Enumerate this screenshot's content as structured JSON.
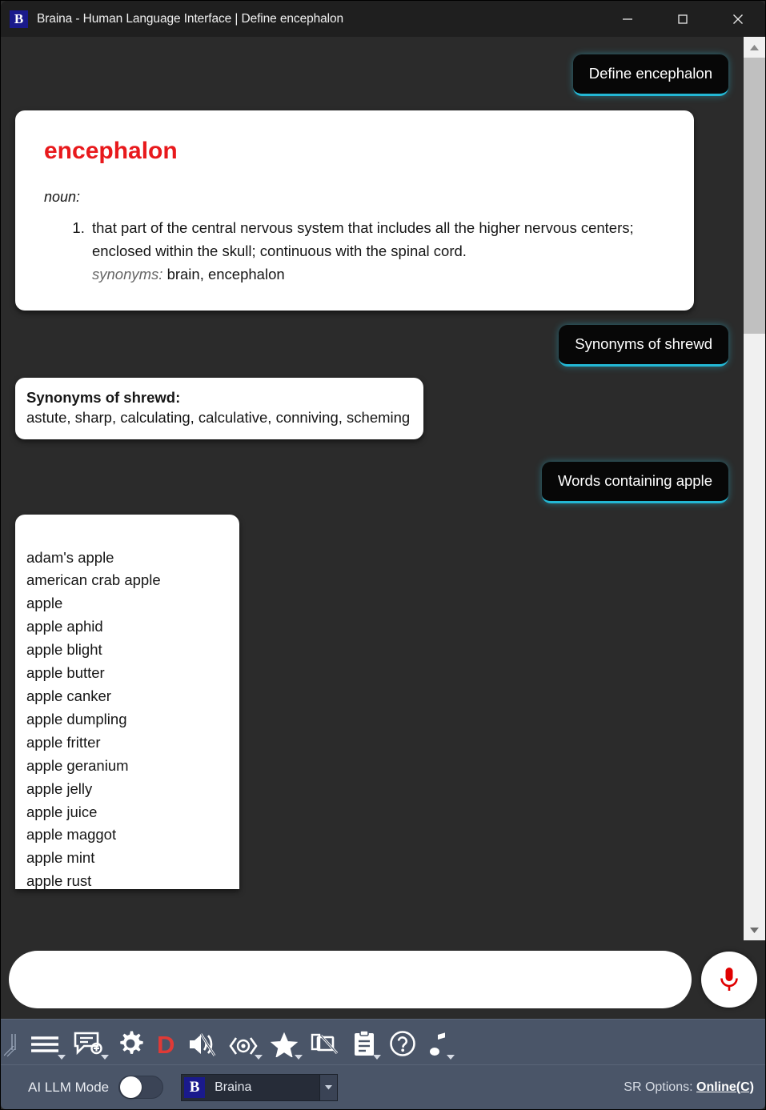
{
  "window": {
    "logo_letter": "B",
    "title": "Braina - Human Language Interface | Define encephalon",
    "controls": {
      "minimize": "minimize-button",
      "maximize": "maximize-button",
      "close": "close-button"
    }
  },
  "conversation": [
    {
      "role": "user",
      "text": "Define encephalon"
    },
    {
      "role": "assistant",
      "type": "definition",
      "headword": "encephalon",
      "part_of_speech": "noun:",
      "definitions": [
        "that part of the central nervous system that includes all the higher nervous centers; enclosed within the skull; continuous with the spinal cord."
      ],
      "synonyms_label": "synonyms:",
      "synonyms_value": "brain, encephalon"
    },
    {
      "role": "user",
      "text": "Synonyms of shrewd"
    },
    {
      "role": "assistant",
      "type": "synonyms",
      "title": "Synonyms of shrewd:",
      "body": "astute, sharp, calculating, calculative, conniving, scheming"
    },
    {
      "role": "user",
      "text": "Words containing apple"
    },
    {
      "role": "assistant",
      "type": "word-list",
      "items": [
        "adam's apple",
        "american crab apple",
        "apple",
        "apple aphid",
        "apple blight",
        "apple butter",
        "apple canker",
        "apple dumpling",
        "apple fritter",
        "apple geranium",
        "apple jelly",
        "apple juice",
        "apple maggot",
        "apple mint",
        "apple rust"
      ]
    }
  ],
  "input": {
    "value": "",
    "placeholder": "",
    "mic_label": "microphone"
  },
  "toolbar": {
    "items": [
      {
        "name": "menu-icon",
        "label": "Menu",
        "has_caret": true
      },
      {
        "name": "new-chat-icon",
        "label": "New Chat",
        "has_caret": true
      },
      {
        "name": "gear-icon",
        "label": "Settings",
        "has_caret": false
      },
      {
        "name": "dictionary-icon",
        "label": "D",
        "has_caret": false
      },
      {
        "name": "mute-icon",
        "label": "Mute",
        "has_caret": false
      },
      {
        "name": "watch-icon",
        "label": "Watch",
        "has_caret": true
      },
      {
        "name": "star-icon",
        "label": "Favorites",
        "has_caret": true
      },
      {
        "name": "screen-off-icon",
        "label": "Screen Off",
        "has_caret": false
      },
      {
        "name": "clipboard-icon",
        "label": "Clipboard",
        "has_caret": true
      },
      {
        "name": "help-icon",
        "label": "Help",
        "has_caret": false
      },
      {
        "name": "music-icon",
        "label": "Music",
        "has_caret": true
      }
    ]
  },
  "statusbar": {
    "llm_mode_label": "AI LLM Mode",
    "llm_mode_on": false,
    "model_logo_letter": "B",
    "model_name": "Braina",
    "sr_options_label": "SR Options:",
    "sr_options_value": "Online(C)"
  },
  "colors": {
    "accent_cyan": "#23b7d4",
    "headword_red": "#e8191c",
    "toolbar_blue_gray": "#4a5568",
    "brand_blue": "#1a1a8c",
    "mic_red": "#e00000"
  }
}
